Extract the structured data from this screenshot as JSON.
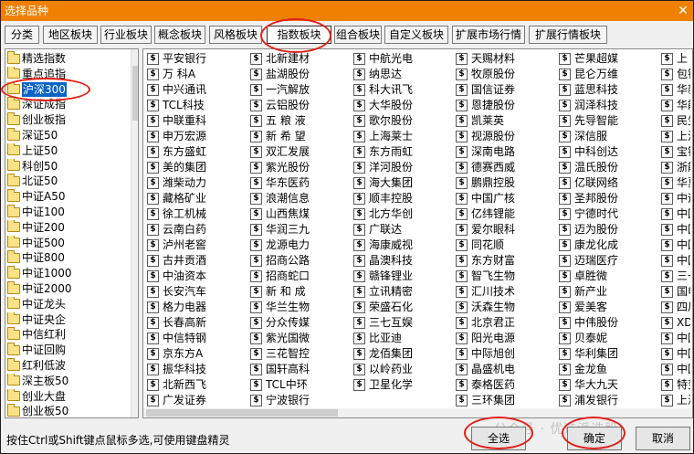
{
  "window": {
    "title": "选择品种",
    "close_glyph": "✕"
  },
  "tabs": [
    {
      "label": "分类"
    },
    {
      "label": "地区板块"
    },
    {
      "label": "行业板块"
    },
    {
      "label": "概念板块"
    },
    {
      "label": "风格板块"
    },
    {
      "label": "指数板块"
    },
    {
      "label": "组合板块"
    },
    {
      "label": "自定义板块"
    },
    {
      "label": "扩展市场行情"
    },
    {
      "label": "扩展行情板块"
    }
  ],
  "active_tab": "指数板块",
  "tree": {
    "items": [
      "精选指数",
      "重点追指",
      "沪深300",
      "深证成指",
      "创业板指",
      "深证50",
      "上证50",
      "科创50",
      "北证50",
      "中证A50",
      "中证100",
      "中证200",
      "中证500",
      "中证800",
      "中证1000",
      "中证2000",
      "中证龙头",
      "中证央企",
      "中信红利",
      "中证回购",
      "红利低波",
      "深主板50",
      "创业大盘",
      "创业板50"
    ],
    "selected": "沪深300"
  },
  "columns": [
    [
      "平安银行",
      "万 科A",
      "中兴通讯",
      "TCL科技",
      "中联重科",
      "申万宏源",
      "东方盛虹",
      "美的集团",
      "潍柴动力",
      "藏格矿业",
      "徐工机械",
      "云南白药",
      "泸州老窖",
      "古井贡酒",
      "中油资本",
      "长安汽车",
      "格力电器",
      "长春高新",
      "中信特钢",
      "京东方A",
      "振华科技",
      "北新西飞",
      "广发证券"
    ],
    [
      "北新建材",
      "盐湖股份",
      "一汽解放",
      "云铝股份",
      "五 粮 液",
      "新 希 望",
      "双汇发展",
      "紫光股份",
      "华东医药",
      "浪潮信息",
      "山西焦煤",
      "华润三九",
      "龙源电力",
      "招商公路",
      "招商蛇口",
      "新 和 成",
      "华兰生物",
      "分众传媒",
      "紫光国微",
      "三花智控",
      "国轩高科",
      "TCL中环",
      "宁波银行"
    ],
    [
      "中航光电",
      "纳思达",
      "科大讯飞",
      "大华股份",
      "歌尔股份",
      "上海莱士",
      "东方雨虹",
      "洋河股份",
      "海大集团",
      "顺丰控股",
      "北方华创",
      "广联达",
      "海康威视",
      "晶澳科技",
      "赣锋锂业",
      "立讯精密",
      "荣盛石化",
      "三七互娱",
      "比亚迪",
      "龙佰集团",
      "以岭药业",
      "卫星化学"
    ],
    [
      "天赐材料",
      "牧原股份",
      "国信证券",
      "恩捷股份",
      "凯莱英",
      "视源股份",
      "深南电路",
      "德赛西威",
      "鹏鼎控股",
      "中国广核",
      "亿纬锂能",
      "爱尔眼科",
      "同花顺",
      "东方财富",
      "智飞生物",
      "汇川技术",
      "沃森生物",
      "北京君正",
      "阳光电源",
      "中际旭创",
      "晶盛机电",
      "泰格医药",
      "三环集团"
    ],
    [
      "芒果超媒",
      "昆仑万维",
      "蓝思科技",
      "润泽科技",
      "先导智能",
      "深信服",
      "中科创达",
      "温氏股份",
      "亿联网络",
      "圣邦股份",
      "宁德时代",
      "迈为股份",
      "康龙化成",
      "迈瑞医疗",
      "卓胜微",
      "新产业",
      "爱美客",
      "中伟股份",
      "贝泰妮",
      "华利集团",
      "金龙鱼",
      "华大九天",
      "浦发银行"
    ],
    [
      "上",
      "包钢",
      "华新",
      "华能",
      "民生",
      "上汽",
      "宝钢",
      "浙能",
      "华夏",
      "中远",
      "中国",
      "中国",
      "中国",
      "中国",
      "三一",
      "国电",
      "四川",
      "XD伊",
      "中国",
      "中国",
      "中国",
      "特变",
      "上海"
    ]
  ],
  "hint": "按住Ctrl或Shift键点鼠标多选,可使用键盘精灵",
  "buttons": {
    "select_all": "全选",
    "confirm": "确定",
    "cancel": "取消"
  },
  "watermark": "公众号 · 优选派选股",
  "colors": {
    "title_bar": "#f08000",
    "selection": "#0a64c8",
    "annotation": "#e0201a"
  }
}
